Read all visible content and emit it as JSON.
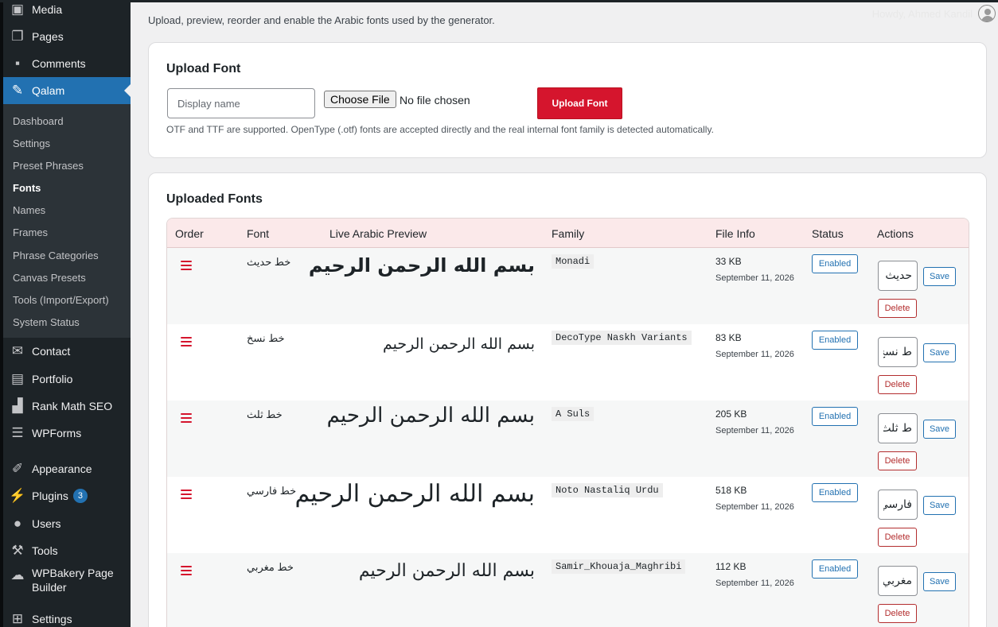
{
  "adminbar": {
    "howdy": "Howdy, Ahmed Kandil"
  },
  "sidebar": {
    "items": [
      {
        "label": "Media",
        "icon": "media-icon"
      },
      {
        "label": "Pages",
        "icon": "pages-icon"
      },
      {
        "label": "Comments",
        "icon": "comments-icon"
      },
      {
        "label": "Qalam",
        "icon": "qalam-pen-icon"
      },
      {
        "label": "Contact",
        "icon": "envelope-icon"
      },
      {
        "label": "Portfolio",
        "icon": "portfolio-icon"
      },
      {
        "label": "Rank Math SEO",
        "icon": "rank-math-icon"
      },
      {
        "label": "WPForms",
        "icon": "forms-icon"
      },
      {
        "label": "Appearance",
        "icon": "brush-icon"
      },
      {
        "label": "Plugins",
        "icon": "plugins-icon",
        "badge": "3"
      },
      {
        "label": "Users",
        "icon": "users-icon"
      },
      {
        "label": "Tools",
        "icon": "wrench-icon"
      },
      {
        "label": "WPBakery Page",
        "label2": "Builder",
        "icon": "wpbakery-icon"
      },
      {
        "label": "Settings",
        "icon": "settings-icon"
      }
    ],
    "submenu": [
      "Dashboard",
      "Settings",
      "Preset Phrases",
      "Fonts",
      "Names",
      "Frames",
      "Phrase Categories",
      "Canvas Presets",
      "Tools (Import/Export)",
      "System Status"
    ]
  },
  "page": {
    "description": "Upload, preview, reorder and enable the Arabic fonts used by the generator."
  },
  "upload": {
    "title": "Upload Font",
    "name_placeholder": "Display name",
    "choose_label": "Choose File",
    "no_file": "No file chosen",
    "button": "Upload Font",
    "help": "OTF and TTF are supported. OpenType (.otf) fonts are accepted directly and the real internal font family is detected automatically."
  },
  "fonts": {
    "title": "Uploaded Fonts",
    "columns": [
      "Order",
      "Font",
      "Live Arabic Preview",
      "Family",
      "File Info",
      "Status",
      "Actions"
    ],
    "rows": [
      {
        "name": "خط حديث",
        "preview": "بسم الله الرحمن الرحيم",
        "family": "Monadi",
        "size": "33 KB",
        "date": "September 11, 2026",
        "status": "Enabled",
        "label": "حديث",
        "save": "Save",
        "delete": "Delete"
      },
      {
        "name": "خط نسخ",
        "preview": "بسم الله الرحمن الرحيم",
        "family": "DecoType Naskh Variants",
        "size": "83 KB",
        "date": "September 11, 2026",
        "status": "Enabled",
        "label": "ط نسخ",
        "save": "Save",
        "delete": "Delete"
      },
      {
        "name": "خط ثلث",
        "preview": "بسم الله الرحمن الرحيم",
        "family": "A Suls",
        "size": "205 KB",
        "date": "September 11, 2026",
        "status": "Enabled",
        "label": "ط ثلث",
        "save": "Save",
        "delete": "Delete"
      },
      {
        "name": "خط فارسي",
        "preview": "بسم الله الرحمن الرحيم",
        "family": "Noto Nastaliq Urdu",
        "size": "518 KB",
        "date": "September 11, 2026",
        "status": "Enabled",
        "label": "فارسي",
        "save": "Save",
        "delete": "Delete"
      },
      {
        "name": "خط مغربي",
        "preview": "بسم الله الرحمن الرحيم",
        "family": "Samir_Khouaja_Maghribi",
        "size": "112 KB",
        "date": "September 11, 2026",
        "status": "Enabled",
        "label": "مغربي",
        "save": "Save",
        "delete": "Delete"
      }
    ]
  },
  "colors": {
    "accent": "#2271b1",
    "danger": "#d5152d",
    "sidebar": "#1d2327"
  }
}
